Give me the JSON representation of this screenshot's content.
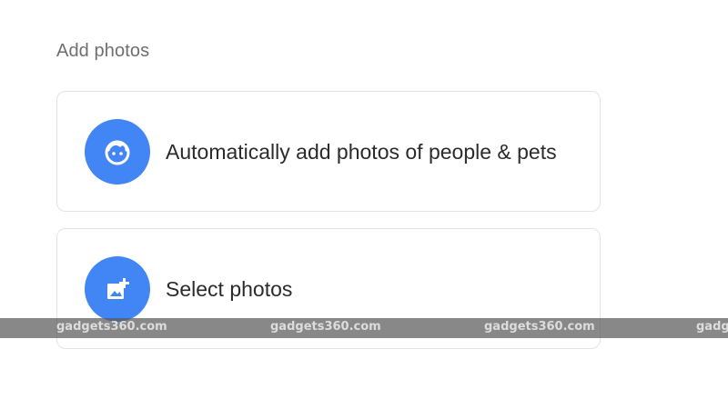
{
  "section": {
    "title": "Add photos"
  },
  "options": [
    {
      "label": "Automatically add photos of people & pets",
      "icon": "face-icon"
    },
    {
      "label": "Select photos",
      "icon": "add-photo-icon"
    }
  ],
  "watermark": {
    "text": [
      "gadgets360.com",
      "gadgets360.com",
      "gadgets360.com",
      "gadge"
    ]
  },
  "colors": {
    "accent": "#4285f4",
    "card_border": "#e3e3e3",
    "title_text": "#6f6f6f",
    "label_text": "#2b2b2b"
  }
}
